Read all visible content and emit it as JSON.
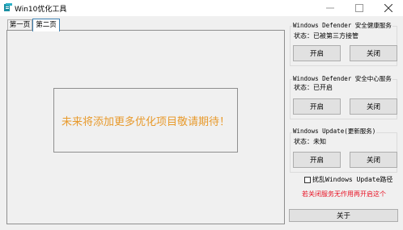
{
  "window": {
    "title": "Win10优化工具",
    "icons": {
      "app": "app-icon",
      "minimize": "minimize-icon",
      "maximize": "maximize-icon",
      "close": "close-icon"
    }
  },
  "tabs": [
    {
      "label": "第一页"
    },
    {
      "label": "第二页"
    }
  ],
  "main": {
    "notice": "未来将添加更多优化项目敬请期待！"
  },
  "groups": [
    {
      "title": "Windows Defender 安全健康服务",
      "status": "状态：已被第三方接管",
      "enable": "开启",
      "disable": "关闭"
    },
    {
      "title": "Windows Defender 安全中心服务",
      "status": "状态：已开启",
      "enable": "开启",
      "disable": "关闭"
    },
    {
      "title": "Windows Update(更新服务)",
      "status": "状态：未知",
      "enable": "开启",
      "disable": "关闭"
    }
  ],
  "options": {
    "scramble_label": "扰乱Windows Update路径",
    "note": "若关闭服务无作用再开启这个"
  },
  "about_label": "关于",
  "colors": {
    "notice": "#e89a2c",
    "warning": "#e81123",
    "selected_tab_border": "#3c7fb1"
  }
}
